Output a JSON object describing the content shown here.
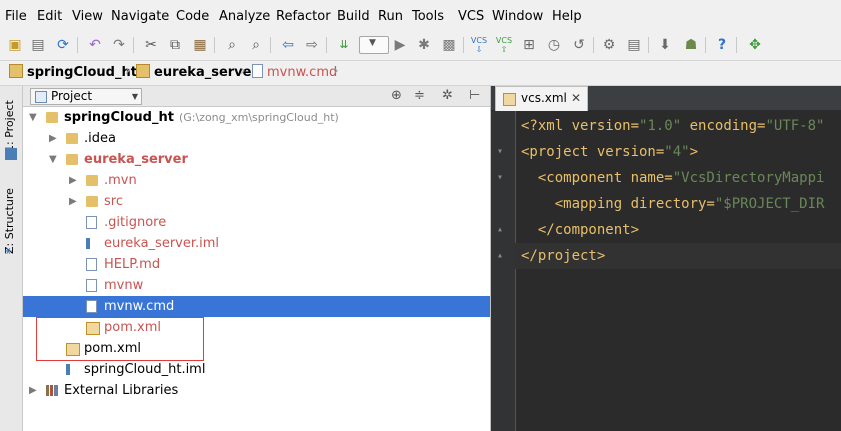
{
  "menu": [
    "File",
    "Edit",
    "View",
    "Navigate",
    "Code",
    "Analyze",
    "Refactor",
    "Build",
    "Run",
    "Tools",
    "VCS",
    "Window",
    "Help"
  ],
  "toolbar": {
    "icons": [
      "open-icon",
      "save-icon",
      "sync-icon",
      "undo-icon",
      "redo-icon",
      "cut-icon",
      "copy-icon",
      "paste-icon",
      "find-icon",
      "replace-icon",
      "back-icon",
      "forward-icon",
      "make-icon",
      "run-config-dropdown",
      "run-icon",
      "debug-icon",
      "coverage-icon",
      "vcs-update-icon",
      "vcs-commit-icon",
      "vcs-compare-icon",
      "vcs-history-icon",
      "vcs-revert-icon",
      "settings-icon",
      "project-structure-icon",
      "sdk-manager-icon",
      "avd-manager-icon",
      "help-icon",
      "plugin-icon"
    ],
    "vcs_label": "VCS"
  },
  "breadcrumb": [
    {
      "label": "springCloud_ht",
      "type": "module"
    },
    {
      "label": "eureka_server",
      "type": "module"
    },
    {
      "label": "mvnw.cmd",
      "type": "file"
    }
  ],
  "side_tabs": [
    "1: Project",
    "Z: Structure"
  ],
  "project_panel": {
    "view_selector": "Project",
    "tree": [
      {
        "label": "springCloud_ht",
        "path": "(G:\\zong_xm\\springCloud_ht)",
        "depth": 0,
        "arrow": "▼",
        "icon": "folder",
        "bold": true,
        "red": false
      },
      {
        "label": ".idea",
        "depth": 1,
        "arrow": "▶",
        "icon": "folder",
        "red": false
      },
      {
        "label": "eureka_server",
        "depth": 1,
        "arrow": "▼",
        "icon": "folder",
        "bold": true,
        "red": true
      },
      {
        "label": ".mvn",
        "depth": 2,
        "arrow": "▶",
        "icon": "folder",
        "red": true
      },
      {
        "label": "src",
        "depth": 2,
        "arrow": "▶",
        "icon": "folder",
        "red": true
      },
      {
        "label": ".gitignore",
        "depth": 2,
        "arrow": "",
        "icon": "file",
        "red": true
      },
      {
        "label": "eureka_server.iml",
        "depth": 2,
        "arrow": "",
        "icon": "iml",
        "red": true
      },
      {
        "label": "HELP.md",
        "depth": 2,
        "arrow": "",
        "icon": "file",
        "red": true
      },
      {
        "label": "mvnw",
        "depth": 2,
        "arrow": "",
        "icon": "file",
        "red": true
      },
      {
        "label": "mvnw.cmd",
        "depth": 2,
        "arrow": "",
        "icon": "file",
        "red": true,
        "selected": true
      },
      {
        "label": "pom.xml",
        "depth": 2,
        "arrow": "",
        "icon": "xml",
        "red": true
      },
      {
        "label": "pom.xml",
        "depth": 1,
        "arrow": "",
        "icon": "xml",
        "red": false
      },
      {
        "label": "springCloud_ht.iml",
        "depth": 1,
        "arrow": "",
        "icon": "iml",
        "red": false
      },
      {
        "label": "External Libraries",
        "depth": 0,
        "arrow": "▶",
        "icon": "lib",
        "red": false
      }
    ]
  },
  "editor": {
    "tab": "vcs.xml",
    "lines": [
      {
        "parts": [
          [
            "pi",
            "<?xml version="
          ],
          [
            "q",
            "\"1.0\""
          ],
          [
            "pi",
            " encoding="
          ],
          [
            "q",
            "\"UTF-8\""
          ]
        ]
      },
      {
        "parts": [
          [
            "pi",
            "<project version="
          ],
          [
            "q",
            "\"4\""
          ],
          [
            "pi",
            ">"
          ]
        ],
        "fold": "▾"
      },
      {
        "parts": [
          [
            "pi",
            "  <component name="
          ],
          [
            "q",
            "\"VcsDirectoryMappi"
          ]
        ],
        "fold": "▾"
      },
      {
        "parts": [
          [
            "pi",
            "    <mapping directory="
          ],
          [
            "q",
            "\"$PROJECT_DIR"
          ]
        ]
      },
      {
        "parts": [
          [
            "pi",
            "  </component>"
          ]
        ],
        "fold": "▴"
      },
      {
        "parts": [
          [
            "pi",
            "</project>"
          ]
        ],
        "fold": "▴",
        "current": true
      }
    ]
  },
  "colors": {
    "selection": "#3875d7",
    "modified": "#c75450",
    "highlight_box": "#e03a3a",
    "editor_bg": "#2b2b2b"
  }
}
